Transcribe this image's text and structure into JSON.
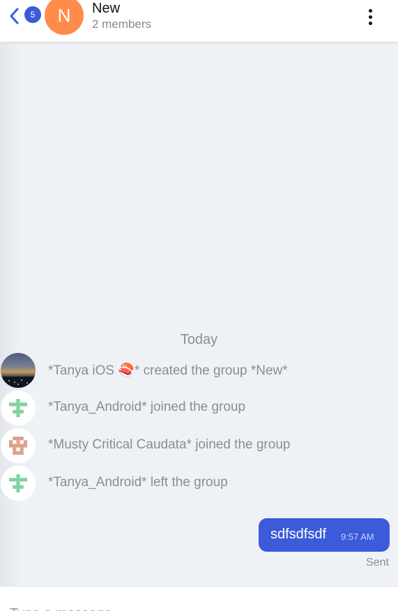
{
  "header": {
    "unread_count": "5",
    "avatar_letter": "N",
    "group_name": "New",
    "members": "2 members"
  },
  "chat": {
    "date_separator": "Today",
    "events": [
      {
        "text": "*Tanya iOS 🍣* created the group *New*",
        "avatar": "photo"
      },
      {
        "text": "*Tanya_Android* joined the group",
        "avatar": "identicon-green"
      },
      {
        "text": "*Musty Critical Caudata* joined the group",
        "avatar": "identicon-tan"
      },
      {
        "text": "*Tanya_Android* left the group",
        "avatar": "identicon-green"
      }
    ],
    "messages": [
      {
        "text": "sdfsdfsdf",
        "time": "9:57 AM",
        "status": "Sent"
      }
    ]
  },
  "composer": {
    "placeholder": "Type a message"
  },
  "colors": {
    "accent": "#3b5bdb",
    "avatar_orange": "#ff8c4a",
    "identicon_green": "#7fd4a0",
    "identicon_tan": "#d9a38a"
  }
}
